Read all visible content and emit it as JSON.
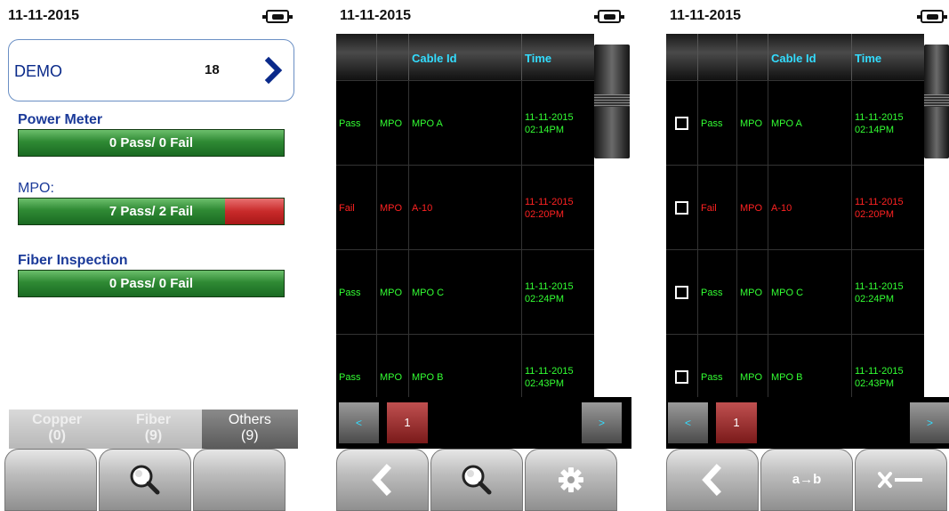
{
  "colors": {
    "pass": "#33ff33",
    "fail": "#ff2222",
    "header_text": "#33ddff",
    "label_blue": "#1b3a99",
    "bar_green": "#2f8a34",
    "bar_red": "#c82a2a"
  },
  "summary_screen": {
    "date": "11-11-2015",
    "project": {
      "name": "DEMO",
      "count": "18",
      "icon": "chevron-right-icon"
    },
    "sections": [
      {
        "label": "Power Meter",
        "status": "0 Pass/ 0 Fail",
        "pass": 0,
        "fail": 0
      },
      {
        "label": "MPO:",
        "status": "7 Pass/ 2 Fail",
        "pass": 7,
        "fail": 2
      },
      {
        "label": "Fiber Inspection",
        "status": "0 Pass/ 0 Fail",
        "pass": 0,
        "fail": 0
      }
    ],
    "tabs": [
      {
        "label": "Copper",
        "count": "(0)"
      },
      {
        "label": "Fiber",
        "count": "(9)"
      },
      {
        "label": "Others",
        "count": "(9)",
        "active": true
      }
    ],
    "softkeys": [
      "",
      "search-icon",
      ""
    ]
  },
  "results_screen": {
    "date": "11-11-2015",
    "columns": [
      "",
      "",
      "Cable Id",
      "Time"
    ],
    "rows": [
      {
        "result": "Pass",
        "type": "MPO",
        "cable_id": "MPO A",
        "date": "11-11-2015",
        "time": "02:14PM"
      },
      {
        "result": "Fail",
        "type": "MPO",
        "cable_id": "A-10",
        "date": "11-11-2015",
        "time": "02:20PM"
      },
      {
        "result": "Pass",
        "type": "MPO",
        "cable_id": "MPO C",
        "date": "11-11-2015",
        "time": "02:24PM"
      },
      {
        "result": "Pass",
        "type": "MPO",
        "cable_id": "MPO B",
        "date": "11-11-2015",
        "time": "02:43PM"
      }
    ],
    "pager": {
      "prev": "<",
      "page": "1",
      "next": ">"
    },
    "softkeys": [
      "back-icon",
      "search-icon",
      "gear-icon"
    ]
  },
  "select_screen": {
    "date": "11-11-2015",
    "columns": [
      "",
      "",
      "",
      "Cable Id",
      "Time"
    ],
    "pager": {
      "prev": "<",
      "page": "1",
      "next": ">"
    },
    "softkeys": [
      "back-icon",
      "rename-icon",
      "delete-icon"
    ],
    "rename_label": "a→b"
  }
}
